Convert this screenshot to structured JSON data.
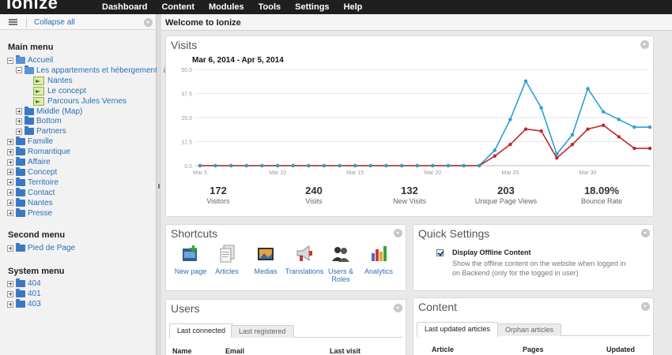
{
  "app": {
    "logo": "Ionize"
  },
  "topnav": [
    "Dashboard",
    "Content",
    "Modules",
    "Tools",
    "Settings",
    "Help"
  ],
  "sidebar": {
    "collapse_label": "Collapse all",
    "main_menu_title": "Main menu",
    "main_menu": [
      {
        "label": "Accueil",
        "level": 0,
        "kind": "folder-open",
        "expanded": true
      },
      {
        "label": "Les appartements et hébergements à Na",
        "level": 1,
        "kind": "folder-open",
        "expanded": true
      },
      {
        "label": "Nantes",
        "level": 2,
        "kind": "page"
      },
      {
        "label": "Le concept",
        "level": 2,
        "kind": "page"
      },
      {
        "label": "Parcours Jules Vernes",
        "level": 2,
        "kind": "page"
      },
      {
        "label": "Middle (Map)",
        "level": 1,
        "kind": "folder"
      },
      {
        "label": "Bottom",
        "level": 1,
        "kind": "folder"
      },
      {
        "label": "Partners",
        "level": 1,
        "kind": "folder"
      },
      {
        "label": "Famille",
        "level": 0,
        "kind": "folder"
      },
      {
        "label": "Romantique",
        "level": 0,
        "kind": "folder"
      },
      {
        "label": "Affaire",
        "level": 0,
        "kind": "folder"
      },
      {
        "label": "Concept",
        "level": 0,
        "kind": "folder"
      },
      {
        "label": "Territoire",
        "level": 0,
        "kind": "folder"
      },
      {
        "label": "Contact",
        "level": 0,
        "kind": "folder"
      },
      {
        "label": "Nantes",
        "level": 0,
        "kind": "folder"
      },
      {
        "label": "Presse",
        "level": 0,
        "kind": "folder"
      }
    ],
    "second_menu_title": "Second menu",
    "second_menu": [
      {
        "label": "Pied de Page"
      }
    ],
    "system_menu_title": "System menu",
    "system_menu": [
      {
        "label": "404"
      },
      {
        "label": "401"
      },
      {
        "label": "403"
      }
    ]
  },
  "main": {
    "title": "Welcome to Ionize",
    "visits": {
      "title": "Visits",
      "date_range": "Mar 6, 2014 - Apr 5, 2014",
      "stats": [
        {
          "value": "172",
          "label": "Visitors"
        },
        {
          "value": "240",
          "label": "Visits"
        },
        {
          "value": "132",
          "label": "New Visits"
        },
        {
          "value": "203",
          "label": "Unique Page Views"
        },
        {
          "value": "18.09%",
          "label": "Bounce Rate"
        }
      ]
    },
    "shortcuts": {
      "title": "Shortcuts",
      "items": [
        {
          "label": "New page",
          "icon": "new-page-icon"
        },
        {
          "label": "Articles",
          "icon": "articles-icon"
        },
        {
          "label": "Medias",
          "icon": "medias-icon"
        },
        {
          "label": "Translations",
          "icon": "translations-icon"
        },
        {
          "label": "Users & Roles",
          "icon": "users-roles-icon"
        },
        {
          "label": "Analytics",
          "icon": "analytics-icon"
        }
      ]
    },
    "quick_settings": {
      "title": "Quick Settings",
      "option_label": "Display Offline Content",
      "option_checked": true,
      "option_desc": "Show the offline content on the website when logged in on Backend (only for the logged in user)"
    },
    "users": {
      "title": "Users",
      "tabs": [
        "Last connected",
        "Last registered"
      ],
      "columns": [
        "Name",
        "Email",
        "Last visit"
      ]
    },
    "content": {
      "title": "Content",
      "tabs": [
        "Last updated articles",
        "Orphan articles"
      ],
      "columns": [
        "Article",
        "Pages",
        "Updated"
      ]
    }
  },
  "colors": {
    "visits_blue": "#2a9fd6",
    "visitors_red": "#c0282b",
    "link": "#2a6fb8",
    "topbar": "#1f1f1f"
  },
  "chart_data": {
    "type": "line",
    "title": "Mar 6, 2014 - Apr 5, 2014",
    "x": [
      "Mar 5",
      "Mar 6",
      "Mar 7",
      "Mar 8",
      "Mar 9",
      "Mar 10",
      "Mar 11",
      "Mar 12",
      "Mar 13",
      "Mar 14",
      "Mar 15",
      "Mar 16",
      "Mar 17",
      "Mar 18",
      "Mar 19",
      "Mar 20",
      "Mar 21",
      "Mar 22",
      "Mar 23",
      "Mar 24",
      "Mar 25",
      "Mar 26",
      "Mar 27",
      "Mar 28",
      "Mar 29",
      "Mar 30",
      "Mar 31",
      "Apr 1",
      "Apr 2",
      "Apr 3"
    ],
    "x_tick_labels": [
      "Mar 5",
      "Mar 10",
      "Mar 15",
      "Mar 20",
      "Mar 25",
      "Mar 30"
    ],
    "y_tick_labels": [
      "0.0",
      "12.5",
      "25.0",
      "37.5",
      "50.0"
    ],
    "ylim": [
      0,
      50
    ],
    "series": [
      {
        "color": "#2a9fd6",
        "values": [
          0,
          0,
          0,
          0,
          0,
          0,
          0,
          0,
          0,
          0,
          0,
          0,
          0,
          0,
          0,
          0,
          0,
          0,
          0,
          8,
          24,
          44,
          30,
          6,
          16,
          40,
          28,
          24,
          20,
          20
        ]
      },
      {
        "color": "#c0282b",
        "values": [
          0,
          0,
          0,
          0,
          0,
          0,
          0,
          0,
          0,
          0,
          0,
          0,
          0,
          0,
          0,
          0,
          0,
          0,
          0,
          5,
          11,
          19,
          18,
          4,
          11,
          19,
          21,
          15,
          9,
          9
        ]
      }
    ],
    "grid": true,
    "legend": "none"
  }
}
